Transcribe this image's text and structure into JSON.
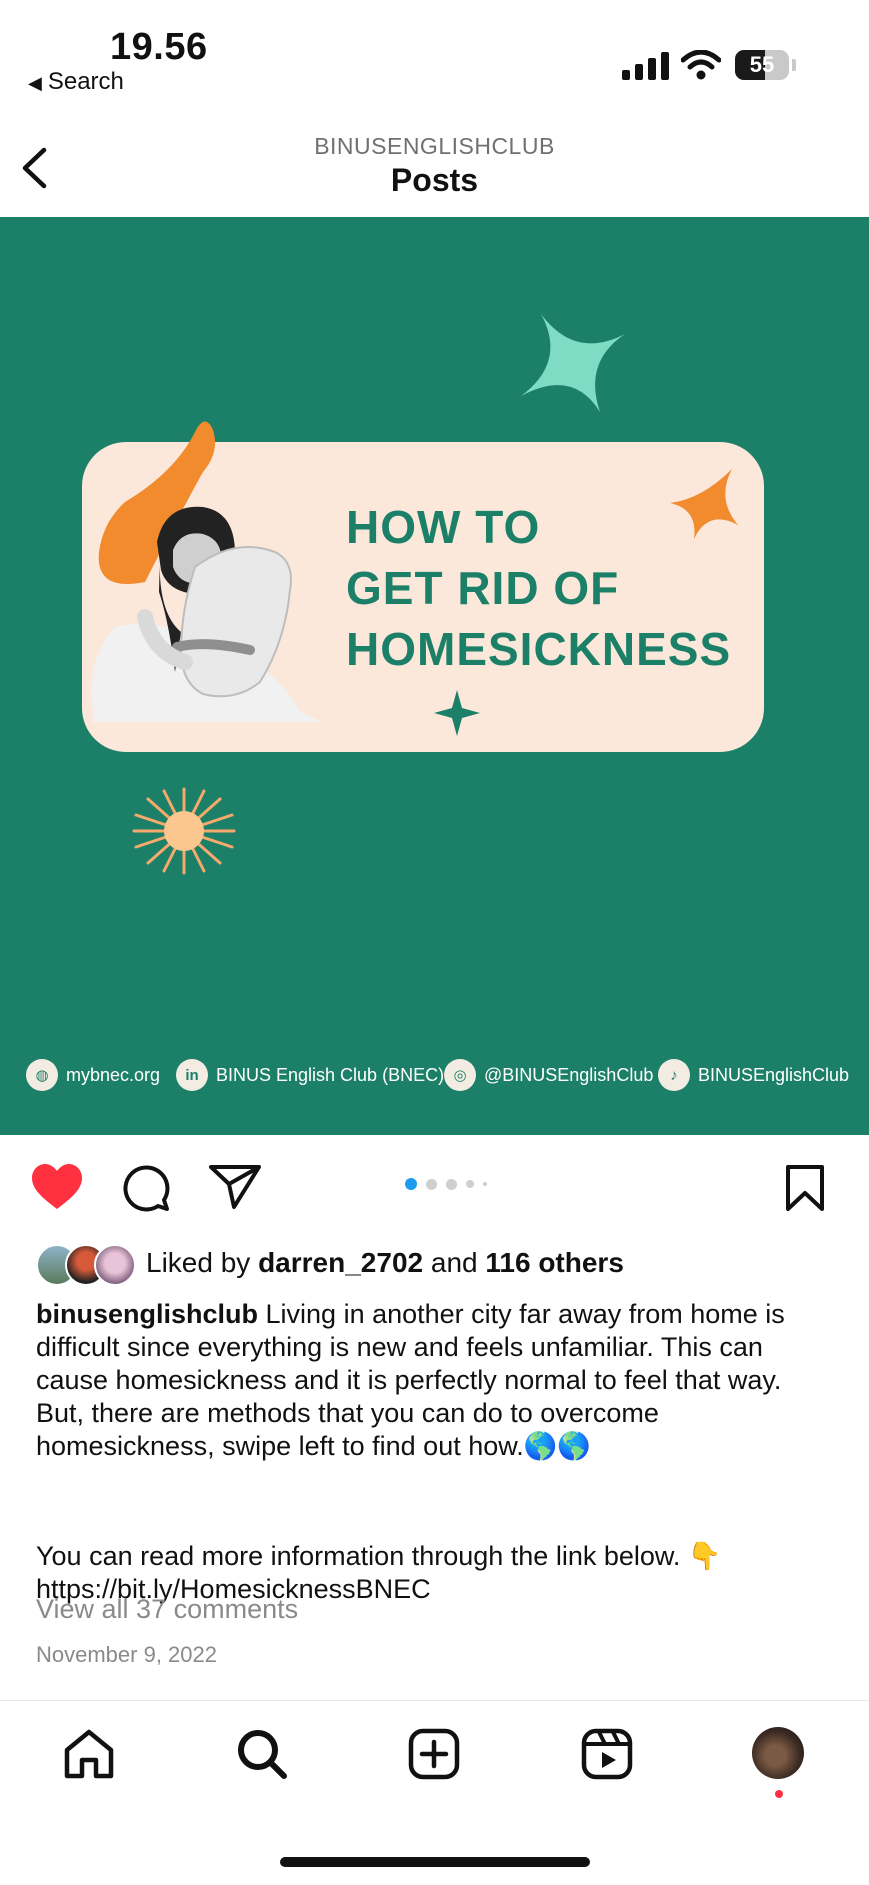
{
  "status": {
    "time": "19.56",
    "back_label": "Search",
    "battery": "55",
    "battery_level": 0.55
  },
  "header": {
    "account": "BINUSENGLISHCLUB",
    "title": "Posts"
  },
  "post_image": {
    "headline": [
      "HOW TO",
      "GET RID OF",
      "HOMESICKNESS"
    ],
    "socials": [
      {
        "icon": "globe-icon",
        "text": "mybnec.org"
      },
      {
        "icon": "linkedin-icon",
        "text": "BINUS English Club (BNEC)"
      },
      {
        "icon": "instagram-icon",
        "text": "@BINUSEnglishClub"
      },
      {
        "icon": "tiktok-icon",
        "text": "BINUSEnglishClub"
      }
    ],
    "colors": {
      "background": "#1c8068",
      "card": "#fbe8da",
      "accent_orange": "#f28a2e",
      "accent_mint": "#7fdcc4"
    }
  },
  "actions": {
    "liked": true,
    "like_color": "#ff3040",
    "carousel_active": 0,
    "carousel_count": 5
  },
  "likes": {
    "prefix": "Liked by",
    "user": "darren_2702",
    "middle": "and",
    "others": "116 others"
  },
  "caption": {
    "username": "binusenglishclub",
    "text": "Living in another city far away from home is difficult since everything is new and feels unfamiliar. This can cause homesickness and it is perfectly normal to feel that way. But, there are methods that you can do to overcome homesickness, swipe left to find out how.🌎🌎",
    "more_line": "You can read more information through the link below. 👇",
    "link": "https://bit.ly/HomesicknessBNEC"
  },
  "comments_label": "View all 37 comments",
  "date": "November 9, 2022",
  "tabbar": {
    "items": [
      "home-icon",
      "search-icon",
      "new-post-icon",
      "reels-icon",
      "profile-avatar"
    ]
  }
}
